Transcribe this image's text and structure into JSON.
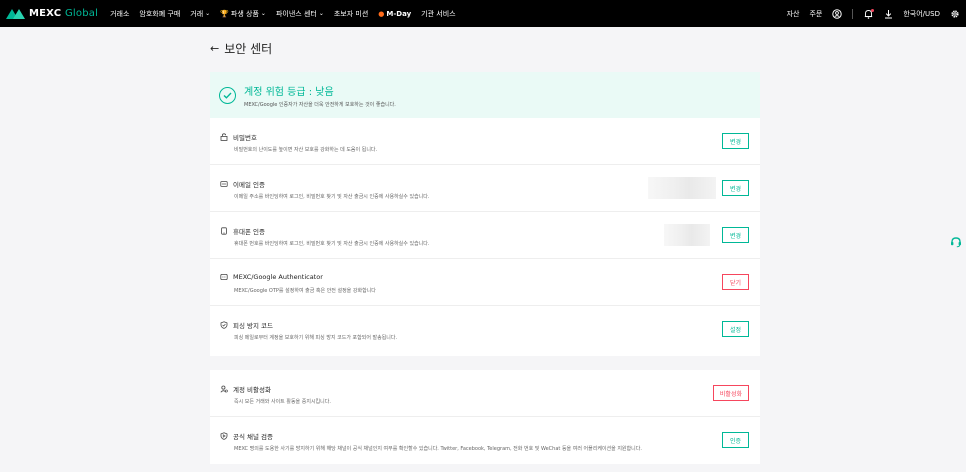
{
  "brand": {
    "name": "MEXC",
    "suffix": "Global"
  },
  "nav": {
    "items": [
      {
        "label": "거래소",
        "chevron": false
      },
      {
        "label": "암호화폐 구매",
        "chevron": false
      },
      {
        "label": "거래",
        "chevron": true
      },
      {
        "label": "파생 상품",
        "chevron": true
      },
      {
        "label": "파이낸스 센터",
        "chevron": true
      },
      {
        "label": "초보자 미션",
        "chevron": false
      },
      {
        "label": "M-Day",
        "chevron": false
      },
      {
        "label": "기관 서비스",
        "chevron": false
      }
    ],
    "right": {
      "assets": "자산",
      "orders": "주문",
      "language": "한국어/USD"
    }
  },
  "page": {
    "title": "보안 센터"
  },
  "banner": {
    "title": "계정 위험 등급 : 낮음",
    "subtitle": "MEXC/Google 인증자가 자산을 더욱 안전하게 보호하는 것이 좋습니다."
  },
  "security_items": [
    {
      "title": "비밀번호",
      "desc": "비밀번호의 난이도를 높이면 자산 보호를 강화하는 데 도움이 됩니다.",
      "action": "변경",
      "danger": false,
      "icon": "lock-icon"
    },
    {
      "title": "이메일 인증",
      "desc": "이메일 주소를 바인딩하여 로그인, 비밀번호 찾기 및 자산 출금시 인증에 사용하실수 있습니다.",
      "action": "변경",
      "danger": false,
      "icon": "email-icon"
    },
    {
      "title": "휴대폰 인증",
      "desc": "휴대폰 번호를 바인딩하여 로그인, 비밀번호 찾기 및 자산 출금시 인증에 사용하실수 있습니다.",
      "action": "변경",
      "danger": false,
      "icon": "phone-icon"
    },
    {
      "title": "MEXC/Google Authenticator",
      "desc": "MEXC/Google OTP를 설정하여 출금 혹은 안전 설정을 강화합니다",
      "action": "닫기",
      "danger": true,
      "icon": "authenticator-icon"
    },
    {
      "title": "피싱 방지 코드",
      "desc": "피싱 메일로부터 계정을 보호하기 위해 피싱 방지 코드가 포함되어 발송됩니다.",
      "action": "설정",
      "danger": false,
      "icon": "shield-icon"
    }
  ],
  "account_items": [
    {
      "title": "계정 비활성화",
      "desc": "즉시 모든 거래와 사이트 활동을 중지시킵니다.",
      "action": "비활성화",
      "danger": true,
      "icon": "user-disable-icon"
    },
    {
      "title": "공식 채널 검증",
      "desc": "MEXC 명의를 도용한 사기를 방지하기 위해 해당 채널이 공식 채널인지 여부를 확인할수 있습니다. Twitter, Facebook, Telegram, 전화 번호 및 WeChat 등을 여러 어플리케이션을 지원합니다.",
      "action": "인증",
      "danger": false,
      "icon": "verified-channel-icon"
    }
  ],
  "colors": {
    "accent": "#00b897",
    "danger": "#f6465d",
    "banner_bg": "#eafaf6",
    "nav_bg": "#000000"
  }
}
